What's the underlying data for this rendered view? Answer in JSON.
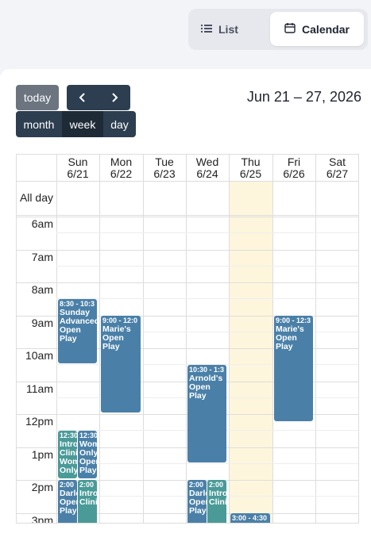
{
  "view_toggle": {
    "list_label": "List",
    "calendar_label": "Calendar"
  },
  "toolbar": {
    "today_label": "today",
    "prev_icon": "chevron-left-icon",
    "next_icon": "chevron-right-icon",
    "month_label": "month",
    "week_label": "week",
    "day_label": "day",
    "range_title": "Jun 21 – 27, 2026"
  },
  "days": [
    {
      "dow": "Sun",
      "date": "6/21"
    },
    {
      "dow": "Mon",
      "date": "6/22"
    },
    {
      "dow": "Tue",
      "date": "6/23"
    },
    {
      "dow": "Wed",
      "date": "6/24"
    },
    {
      "dow": "Thu",
      "date": "6/25"
    },
    {
      "dow": "Fri",
      "date": "6/26"
    },
    {
      "dow": "Sat",
      "date": "6/27"
    }
  ],
  "all_day_label": "All day",
  "time_labels": [
    "6am",
    "7am",
    "8am",
    "9am",
    "10am",
    "11am",
    "12pm",
    "1pm",
    "2pm",
    "3pm"
  ],
  "colors": {
    "dark": "#2c3e50",
    "event_blue": "#4a80a8",
    "event_teal": "#4a9a98",
    "today_bg": "#fdf6dc"
  },
  "events": [
    {
      "day": 0,
      "start": 8.5,
      "end": 10.5,
      "time": "8:30 - 10:3",
      "title": "Sunday Advanced Open Play",
      "color": "#4a80a8",
      "sub": 0,
      "subs": 1
    },
    {
      "day": 1,
      "start": 9.0,
      "end": 12.0,
      "time": "9:00 - 12:0",
      "title": "Marie's Open Play",
      "color": "#4a80a8",
      "sub": 0,
      "subs": 1
    },
    {
      "day": 3,
      "start": 10.5,
      "end": 13.5,
      "time": "10:30 - 1:3",
      "title": "Arnold's Open Play",
      "color": "#4a80a8",
      "sub": 0,
      "subs": 1
    },
    {
      "day": 5,
      "start": 9.0,
      "end": 12.25,
      "time": "9:00 - 12:3",
      "title": "Marie's Open Play",
      "color": "#4a80a8",
      "sub": 0,
      "subs": 1
    },
    {
      "day": 0,
      "start": 12.5,
      "end": 14.0,
      "time": "12:30",
      "title": "Intro Clinic Women Only",
      "color": "#4a9a98",
      "sub": 0,
      "subs": 2
    },
    {
      "day": 0,
      "start": 12.5,
      "end": 14.0,
      "time": "12:30",
      "title": "Women Only Open Play",
      "color": "#4a80a8",
      "sub": 1,
      "subs": 2
    },
    {
      "day": 0,
      "start": 14.0,
      "end": 16.0,
      "time": "2:00",
      "title": "Darlene's Open Play",
      "color": "#4a80a8",
      "sub": 0,
      "subs": 2
    },
    {
      "day": 0,
      "start": 14.0,
      "end": 16.0,
      "time": "2:00",
      "title": "Intro Clinic",
      "color": "#4a9a98",
      "sub": 1,
      "subs": 2
    },
    {
      "day": 3,
      "start": 14.0,
      "end": 16.0,
      "time": "2:00",
      "title": "Darlene's Open Play",
      "color": "#4a80a8",
      "sub": 0,
      "subs": 2
    },
    {
      "day": 3,
      "start": 14.0,
      "end": 16.0,
      "time": "2:00",
      "title": "Intro Clinic",
      "color": "#4a9a98",
      "sub": 1,
      "subs": 2
    },
    {
      "day": 4,
      "start": 15.0,
      "end": 16.5,
      "time": "3:00 - 4:30",
      "title": "",
      "color": "#4a80a8",
      "sub": 0,
      "subs": 1
    }
  ]
}
